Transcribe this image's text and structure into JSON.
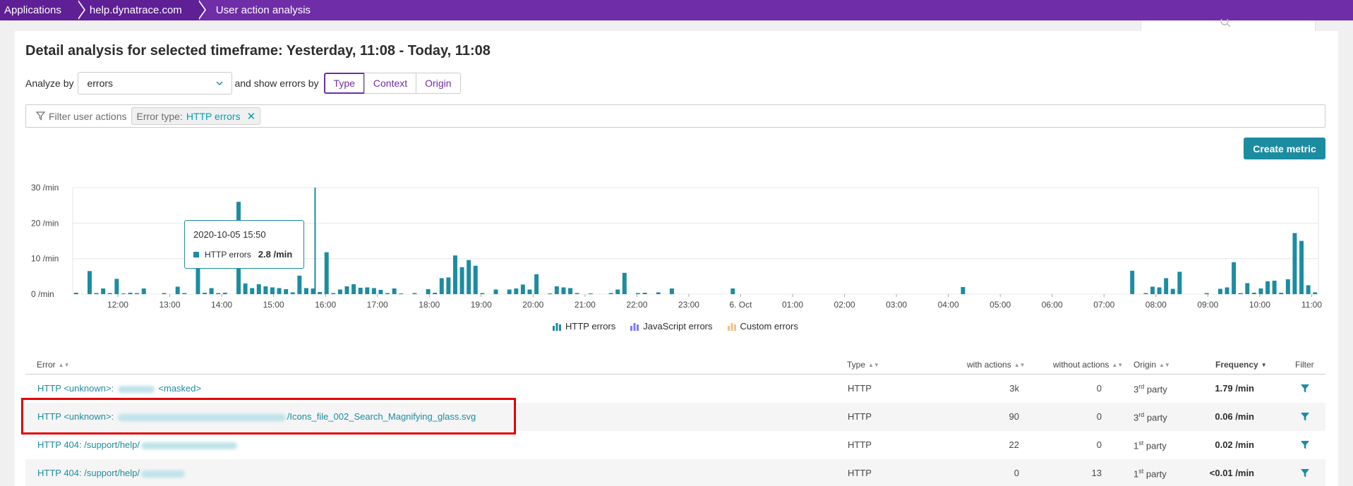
{
  "breadcrumb": [
    "Applications",
    "help.dynatrace.com",
    "User action analysis"
  ],
  "title": "Detail analysis for selected timeframe: Yesterday, 11:08 - Today, 11:08",
  "analyze": {
    "label": "Analyze by",
    "selected": "errors",
    "show_label": "and show errors by",
    "options": [
      "Type",
      "Context",
      "Origin"
    ],
    "active": "Type"
  },
  "filter": {
    "placeholder": "Filter user actions",
    "chip_key": "Error type:",
    "chip_value": "HTTP errors"
  },
  "create_metric": "Create metric",
  "tooltip": {
    "date": "2020-10-05 15:50",
    "series": "HTTP errors",
    "value": "2.8 /min"
  },
  "legend": [
    "HTTP errors",
    "JavaScript errors",
    "Custom errors"
  ],
  "colors": {
    "accent": "#6f2da8",
    "teal": "#1c8ca1",
    "http": "#1c8ca1",
    "javascript": "#7c7cff",
    "custom": "#f5a623",
    "highlight": "#e00000"
  },
  "chart_data": {
    "type": "bar",
    "title": "",
    "xlabel": "",
    "ylabel": "",
    "ylim": [
      0,
      30
    ],
    "yticks": [
      "0 /min",
      "10 /min",
      "20 /min",
      "30 /min"
    ],
    "xticks": [
      "12:00",
      "13:00",
      "14:00",
      "15:00",
      "16:00",
      "17:00",
      "18:00",
      "19:00",
      "20:00",
      "21:00",
      "22:00",
      "23:00",
      "6. Oct",
      "01:00",
      "02:00",
      "03:00",
      "04:00",
      "05:00",
      "06:00",
      "07:00",
      "08:00",
      "09:00",
      "10:00",
      "11:00"
    ],
    "series": [
      {
        "name": "HTTP errors",
        "values": [
          0.4,
          0,
          6.5,
          0.3,
          1.6,
          0.3,
          4.3,
          0.1,
          0.4,
          0.3,
          1.6,
          0,
          0,
          0.3,
          0,
          2.1,
          0.3,
          0,
          7.5,
          0.4,
          1.7,
          0.3,
          0.4,
          0,
          26,
          3,
          1.7,
          2.8,
          2.2,
          1.9,
          1.7,
          1.4,
          0.5,
          5.2,
          1.7,
          1.6,
          0.6,
          11.8,
          0.3,
          1.3,
          2.2,
          2.8,
          1.8,
          1.9,
          1.7,
          1.2,
          0.3,
          1.6,
          0.1,
          0,
          0.3,
          0,
          1.4,
          0.4,
          4.5,
          4.7,
          10.9,
          7.6,
          9.6,
          8,
          0.3,
          0,
          1.3,
          0,
          1.3,
          1.6,
          2.7,
          1.3,
          5.6,
          0,
          0.2,
          2.2,
          1.9,
          1.7,
          0.3,
          0,
          0.2,
          0,
          0,
          0.3,
          1.3,
          6,
          0,
          0.3,
          0.4,
          0,
          0.5,
          0,
          1.6,
          0,
          0,
          0,
          0,
          0,
          0,
          0,
          0,
          1.6,
          0,
          0,
          0,
          0,
          0,
          0,
          0,
          0,
          0,
          0,
          0,
          0,
          0,
          0,
          0,
          0,
          0,
          0,
          0,
          0,
          0,
          0,
          0,
          0,
          0,
          0,
          0,
          0,
          0,
          0,
          0,
          0,
          0,
          2,
          0,
          0,
          0,
          0,
          0,
          0,
          0,
          0,
          0,
          0,
          0,
          0,
          0,
          0,
          0,
          0,
          0,
          0,
          0,
          0,
          0,
          0,
          0,
          0,
          6.6,
          0,
          0.3,
          2.1,
          1.9,
          4.5,
          1.5,
          6.3,
          0,
          0,
          0,
          0.3,
          0,
          1.5,
          1.9,
          9,
          0.3,
          3.1,
          0.4,
          1.6,
          3.6,
          3.8,
          0.4,
          4.2,
          17.2,
          15,
          2.5,
          0.5
        ],
        "spike_marker": 15.8
      }
    ],
    "x_start": 11.13,
    "x_end": 35.13,
    "x_unit": "hours since 2020-10-05 00:00",
    "legend_position": "bottom",
    "grid": true
  },
  "table": {
    "headers": [
      "Error",
      "Type",
      "with actions",
      "without actions",
      "Origin",
      "Frequency",
      "Filter"
    ],
    "rows": [
      {
        "error_prefix": "HTTP <unknown>:",
        "error_suffix": "<masked>",
        "type": "HTTP",
        "with": "3k",
        "without": "0",
        "origin_num": "3",
        "origin_sup": "rd",
        "origin_word": "party",
        "freq": "1.79 /min"
      },
      {
        "error_prefix": "HTTP <unknown>:",
        "error_suffix": "/Icons_file_002_Search_Magnifying_glass.svg",
        "type": "HTTP",
        "with": "90",
        "without": "0",
        "origin_num": "3",
        "origin_sup": "rd",
        "origin_word": "party",
        "freq": "0.06 /min"
      },
      {
        "error_prefix": "HTTP 404: /support/help/",
        "error_suffix": "",
        "type": "HTTP",
        "with": "22",
        "without": "0",
        "origin_num": "1",
        "origin_sup": "st",
        "origin_word": "party",
        "freq": "0.02 /min"
      },
      {
        "error_prefix": "HTTP 404: /support/help/",
        "error_suffix": "",
        "type": "HTTP",
        "with": "0",
        "without": "13",
        "origin_num": "1",
        "origin_sup": "st",
        "origin_word": "party",
        "freq": "<0.01 /min"
      }
    ]
  }
}
